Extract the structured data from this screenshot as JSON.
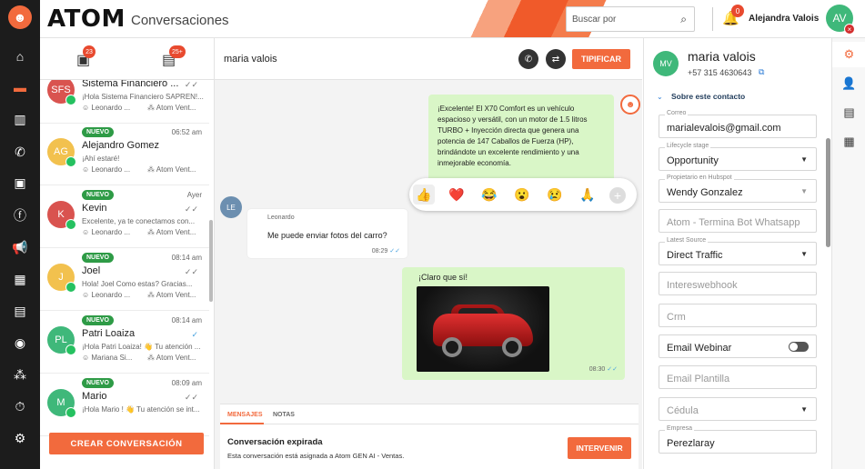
{
  "app": {
    "brand": "ATOM",
    "section_title": "Conversaciones"
  },
  "header": {
    "search_placeholder": "Buscar por",
    "notifications": "0",
    "user_name": "Alejandra Valois",
    "user_initials": "AV"
  },
  "colors": {
    "accent": "#f26a3d",
    "whatsapp": "#25c160",
    "nuevo": "#2e9b46",
    "outgoing_bubble": "#d9f6c7"
  },
  "rail": {
    "items": [
      {
        "icon": "home-icon"
      },
      {
        "icon": "chat-icon"
      },
      {
        "icon": "columns-icon"
      },
      {
        "icon": "phone-icon"
      },
      {
        "icon": "contacts-icon"
      },
      {
        "icon": "facebook-icon"
      },
      {
        "icon": "megaphone-icon"
      },
      {
        "icon": "dashboard-icon"
      },
      {
        "icon": "message-icon"
      },
      {
        "icon": "user-circle-icon"
      },
      {
        "icon": "team-icon"
      },
      {
        "icon": "timer-icon"
      },
      {
        "icon": "settings-icon"
      }
    ]
  },
  "list": {
    "tab_badges": [
      "23",
      "25+"
    ],
    "conversations": [
      {
        "initials": "SFS",
        "color": "#d9534f",
        "name": "Sistema Financiero ...",
        "preview": "¡Hola Sistema Financiero SAPREN!...",
        "agent": "Leonardo ...",
        "team": "Atom Vent...",
        "time": "",
        "nuevo": false
      },
      {
        "initials": "AG",
        "color": "#f2c14e",
        "name": "Alejandro Gomez",
        "preview": "¡Ahí estaré!",
        "agent": "Leonardo ...",
        "team": "Atom Vent...",
        "time": "06:52 am",
        "nuevo": true
      },
      {
        "initials": "K",
        "color": "#d9534f",
        "name": "Kevin",
        "preview": "Excelente, ya te conectamos con...",
        "agent": "Leonardo ...",
        "team": "Atom Vent...",
        "time": "Ayer",
        "nuevo": true
      },
      {
        "initials": "J",
        "color": "#f2c14e",
        "name": "Joel",
        "preview": "Hola! Joel  Como estas? Gracias...",
        "agent": "Leonardo ...",
        "team": "Atom Vent...",
        "time": "08:14 am",
        "nuevo": true
      },
      {
        "initials": "PL",
        "color": "#3fb87a",
        "name": "Patri Loaiza",
        "preview": "¡Hola Patri Loaiza! 👋 Tu atención ...",
        "agent": "Mariana Si...",
        "team": "Atom Vent...",
        "time": "08:14 am",
        "nuevo": true
      },
      {
        "initials": "M",
        "color": "#3fb87a",
        "name": "Mario",
        "preview": "¡Hola Mario ! 👋 Tu atención se int...",
        "agent": "",
        "team": "",
        "time": "08:09 am",
        "nuevo": true
      }
    ],
    "nuevo_label": "NUEVO",
    "create_label": "CREAR CONVERSACIÓN"
  },
  "chat": {
    "contact_name": "maria valois",
    "tipificar_label": "TIPIFICAR",
    "bot_message": "¡Excelente! El X70 Comfort es un vehículo espacioso y versátil, con un motor de 1.5 litros TURBO + Inyección directa que genera una potencia de 147 Caballos de Fuerza (HP), brindándote un excelente rendimiento y una inmejorable economía.",
    "reactions": [
      "👍",
      "❤️",
      "😂",
      "😮",
      "😢",
      "🙏"
    ],
    "incoming": {
      "avatar": "LE",
      "sender": "Leonardo",
      "text": "Me puede enviar fotos del carro?",
      "time": "08:29"
    },
    "outgoing": {
      "text": "¡Claro que sí!",
      "time": "08:30"
    },
    "compose": {
      "tab_messages": "MENSAJES",
      "tab_notes": "NOTAS",
      "expired_title": "Conversación expirada",
      "expired_sub": "Esta conversación está asignada a  Atom GEN AI - Ventas.",
      "intervene_label": "INTERVENIR"
    }
  },
  "contact": {
    "initials": "MV",
    "name": "maria valois",
    "phone": "+57 315 4630643",
    "about_label": "Sobre este contacto",
    "fields": [
      {
        "label": "Correo",
        "value": "marialevalois@gmail.com",
        "placeholder": "",
        "dropdown": false
      },
      {
        "label": "Lifecycle stage",
        "value": "Opportunity",
        "placeholder": "",
        "dropdown": true
      },
      {
        "label": "Propietario en Hubspot",
        "value": "Wendy Gonzalez",
        "placeholder": "",
        "dropdown": true
      },
      {
        "label": "",
        "value": "",
        "placeholder": "Atom - Termina Bot Whatsapp",
        "dropdown": false
      },
      {
        "label": "Latest Source",
        "value": "Direct Traffic",
        "placeholder": "",
        "dropdown": true
      },
      {
        "label": "",
        "value": "",
        "placeholder": "Intereswebhook",
        "dropdown": false
      },
      {
        "label": "",
        "value": "",
        "placeholder": "Crm",
        "dropdown": false
      },
      {
        "label": "",
        "value": "Email Webinar",
        "placeholder": "",
        "dropdown": false,
        "toggle": true
      },
      {
        "label": "",
        "value": "",
        "placeholder": "Email Plantilla",
        "dropdown": false
      },
      {
        "label": "",
        "value": "",
        "placeholder": "Cédula",
        "dropdown": true
      },
      {
        "label": "Empresa",
        "value": "Perezlaray",
        "placeholder": "",
        "dropdown": false
      }
    ]
  },
  "tools": [
    {
      "icon": "hubspot-icon"
    },
    {
      "icon": "person-icon"
    },
    {
      "icon": "document-icon"
    },
    {
      "icon": "calendar-icon"
    }
  ]
}
